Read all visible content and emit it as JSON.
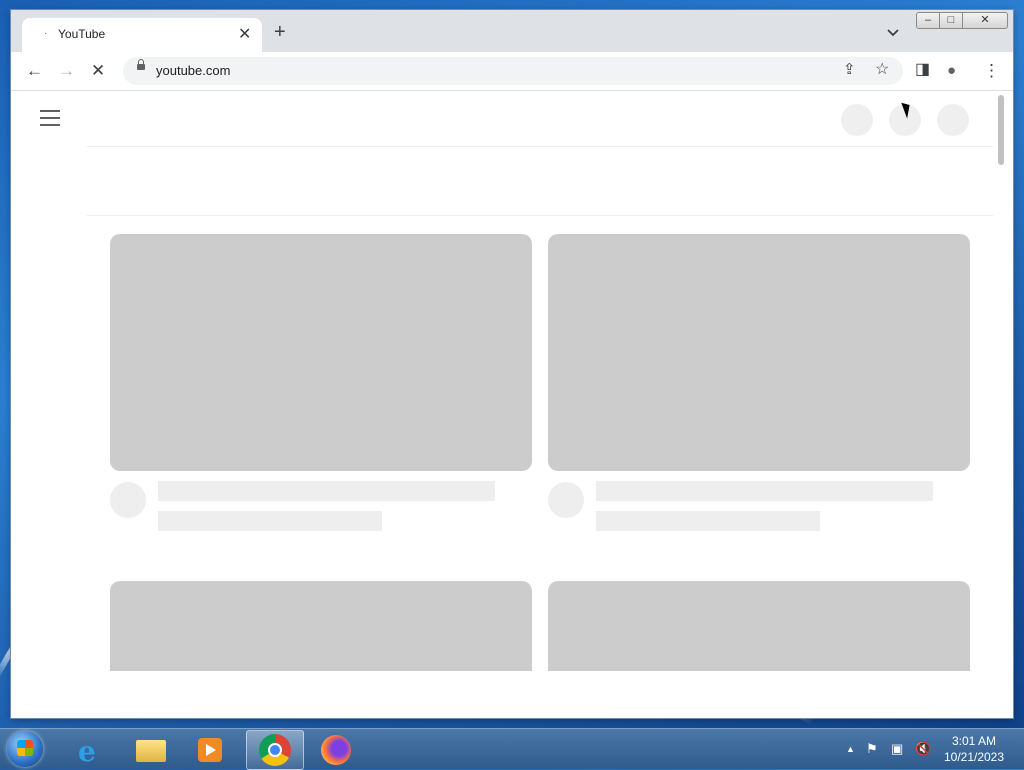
{
  "browser": {
    "tab": {
      "title": "YouTube",
      "favicon": "·",
      "close_label": "✕"
    },
    "new_tab_label": "+",
    "tab_dropdown_label": "⌄",
    "window_controls": {
      "minimize": "–",
      "maximize": "□",
      "close": "✕"
    },
    "toolbar": {
      "back_icon": "←",
      "forward_icon": "→",
      "stop_icon": "✕",
      "share_icon": "⇪",
      "bookmark_icon": "☆",
      "sidepanel_icon": "◨",
      "profile_icon": "●",
      "menu_icon": "⋮"
    },
    "omnibox": {
      "url": "youtube.com"
    }
  },
  "taskbar": {
    "clock_time": "3:01 AM",
    "clock_date": "10/21/2023",
    "tray": {
      "show_hidden": "▲",
      "flag": "⚑",
      "network": "▣",
      "volume": "🔇"
    },
    "apps": [
      "internet-explorer",
      "file-explorer",
      "media-player",
      "chrome",
      "firefox"
    ]
  },
  "colors": {
    "placeholder_thumb": "#cccccc",
    "placeholder_line": "#eeeeee",
    "titlebar": "#dee1e6"
  }
}
